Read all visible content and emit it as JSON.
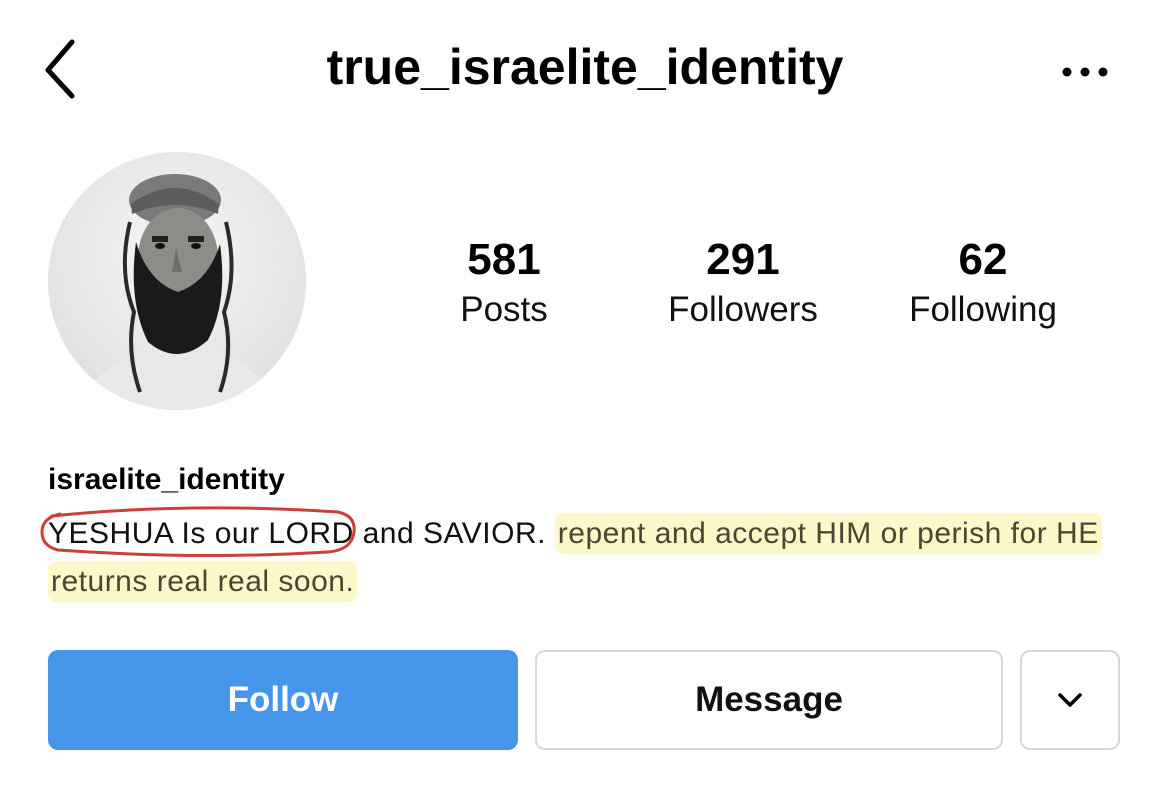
{
  "header": {
    "title": "true_israelite_identity",
    "back_icon": "chevron-left-icon",
    "more_icon": "ellipsis-icon"
  },
  "profile": {
    "avatar": "profile-photo",
    "stats": [
      {
        "value": "581",
        "label": "Posts"
      },
      {
        "value": "291",
        "label": "Followers"
      },
      {
        "value": "62",
        "label": "Following"
      }
    ],
    "display_name": "israelite_identity",
    "bio": {
      "circled_text": "YESHUA Is our LORD",
      "plain_text": " and SAVIOR. ",
      "highlighted_text": "repent and accept HIM or perish for HE returns real real soon."
    }
  },
  "actions": {
    "follow_label": "Follow",
    "message_label": "Message",
    "dropdown_icon": "chevron-down-icon"
  },
  "colors": {
    "follow_button": "#4595eb",
    "highlight": "#fcf8c9",
    "circle_annotation": "#c9403a",
    "button_border": "#d7d7d7"
  }
}
